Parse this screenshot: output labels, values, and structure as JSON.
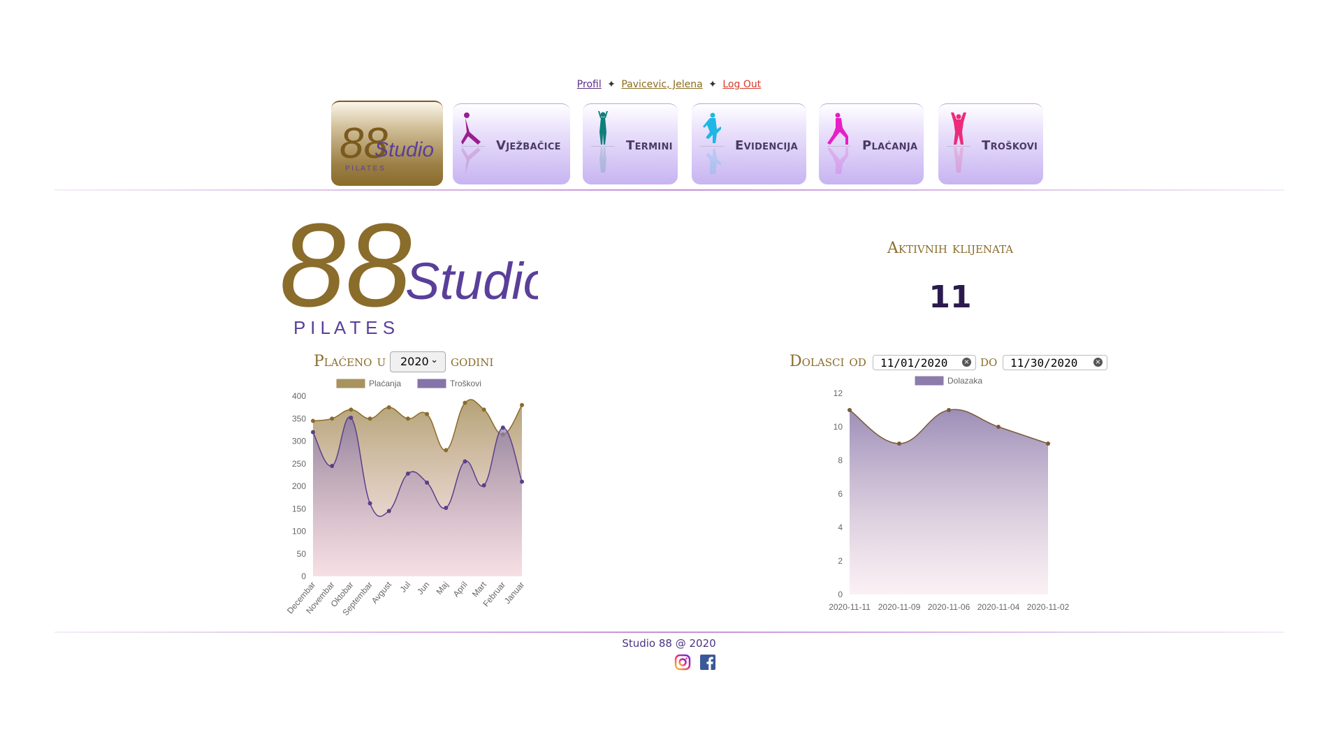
{
  "header": {
    "profile_link": "Profil",
    "user_link": "Pavicevic, Jelena",
    "logout_link": "Log Out",
    "separator": "✦"
  },
  "nav": {
    "home_logo": {
      "main": "88",
      "script": "Studio",
      "sub": "P I L A T E S"
    },
    "items": [
      {
        "label": "Vježbačice",
        "icon": "exercise-figure-icon",
        "color": "#9b1e8e"
      },
      {
        "label": "Termini",
        "icon": "standing-figure-icon",
        "color": "#0e7f7a"
      },
      {
        "label": "Evidencija",
        "icon": "dancing-figure-icon",
        "color": "#1fb6e6"
      },
      {
        "label": "Plaćanja",
        "icon": "kneeling-figure-icon",
        "color": "#e61fc6"
      },
      {
        "label": "Troškovi",
        "icon": "stretch-figure-icon",
        "color": "#ee2a7b"
      }
    ]
  },
  "logo": {
    "main": "88",
    "script": "Studio",
    "sub": "P I L A T E S"
  },
  "active_clients": {
    "title": "Aktivnih klijenata",
    "count": "11"
  },
  "payments": {
    "title_prefix": "Plaćeno u",
    "year": "2020",
    "title_suffix": "godini"
  },
  "arrivals": {
    "title_prefix": "Dolasci od",
    "date_from": "11/01/2020",
    "title_mid": "do",
    "date_to": "11/30/2020"
  },
  "chart_data": [
    {
      "type": "area",
      "categories": [
        "Decembar",
        "Novembar",
        "Oktobar",
        "Septembar",
        "Avgust",
        "Jul",
        "Jun",
        "Maj",
        "April",
        "Mart",
        "Februar",
        "Januar"
      ],
      "series": [
        {
          "name": "Plaćanja",
          "values": [
            345,
            350,
            370,
            350,
            375,
            350,
            360,
            280,
            385,
            370,
            315,
            380
          ],
          "color": "#a8925e"
        },
        {
          "name": "Troškovi",
          "values": [
            320,
            245,
            352,
            162,
            145,
            228,
            208,
            152,
            255,
            202,
            330,
            210
          ],
          "color": "#8574aa"
        }
      ],
      "ylim": [
        0,
        400
      ],
      "yticks": [
        0,
        50,
        100,
        150,
        200,
        250,
        300,
        350,
        400
      ],
      "legend": "top"
    },
    {
      "type": "area",
      "categories": [
        "2020-11-11",
        "2020-11-09",
        "2020-11-06",
        "2020-11-04",
        "2020-11-02"
      ],
      "series": [
        {
          "name": "Dolazaka",
          "values": [
            11,
            9,
            11,
            10,
            9
          ],
          "color": "#8c7bab"
        }
      ],
      "ylim": [
        0,
        12
      ],
      "yticks": [
        0,
        2,
        4,
        6,
        8,
        10,
        12
      ],
      "legend": "top"
    }
  ],
  "footer": {
    "text": "Studio 88 @ 2020",
    "icons": [
      "instagram-icon",
      "facebook-icon"
    ]
  }
}
